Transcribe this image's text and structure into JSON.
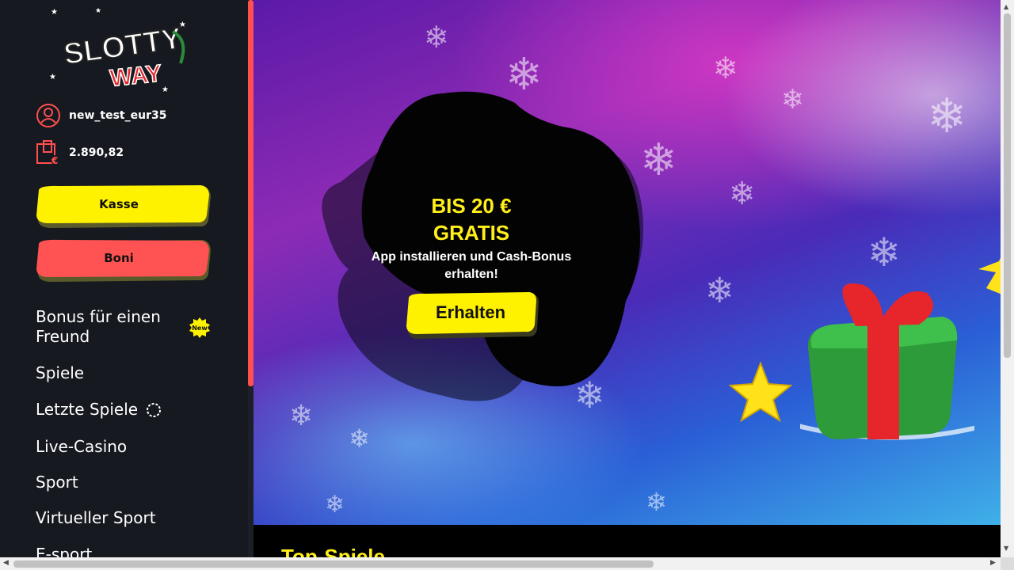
{
  "brand": {
    "logo_line1": "SLOTTY",
    "logo_line2": "WAY"
  },
  "user": {
    "username": "new_test_eur35",
    "balance": "2.890,82"
  },
  "buttons": {
    "kasse": "Kasse",
    "boni": "Boni"
  },
  "menu": {
    "bonus_friend": "Bonus für einen Freund",
    "new_badge": "New",
    "spiele": "Spiele",
    "letzte_spiele": "Letzte Spiele",
    "live_casino": "Live-Casino",
    "sport": "Sport",
    "virtueller_sport": "Virtueller Sport",
    "esport": "E-sport"
  },
  "hero": {
    "title_line1": "BIS 20 €",
    "title_line2": "GRATIS",
    "subtitle": "App installieren und Cash-Bonus erhalten!",
    "cta": "Erhalten"
  },
  "section": {
    "top_games": "Top-Spiele"
  },
  "colors": {
    "accent_yellow": "#ffef1a",
    "accent_red": "#ff5353",
    "sidebar_bg": "#161920"
  },
  "icons": [
    "user-icon",
    "wallet-icon",
    "spinner-icon",
    "new-badge-icon",
    "snowflake-icon",
    "gift-icon",
    "star-icon"
  ]
}
